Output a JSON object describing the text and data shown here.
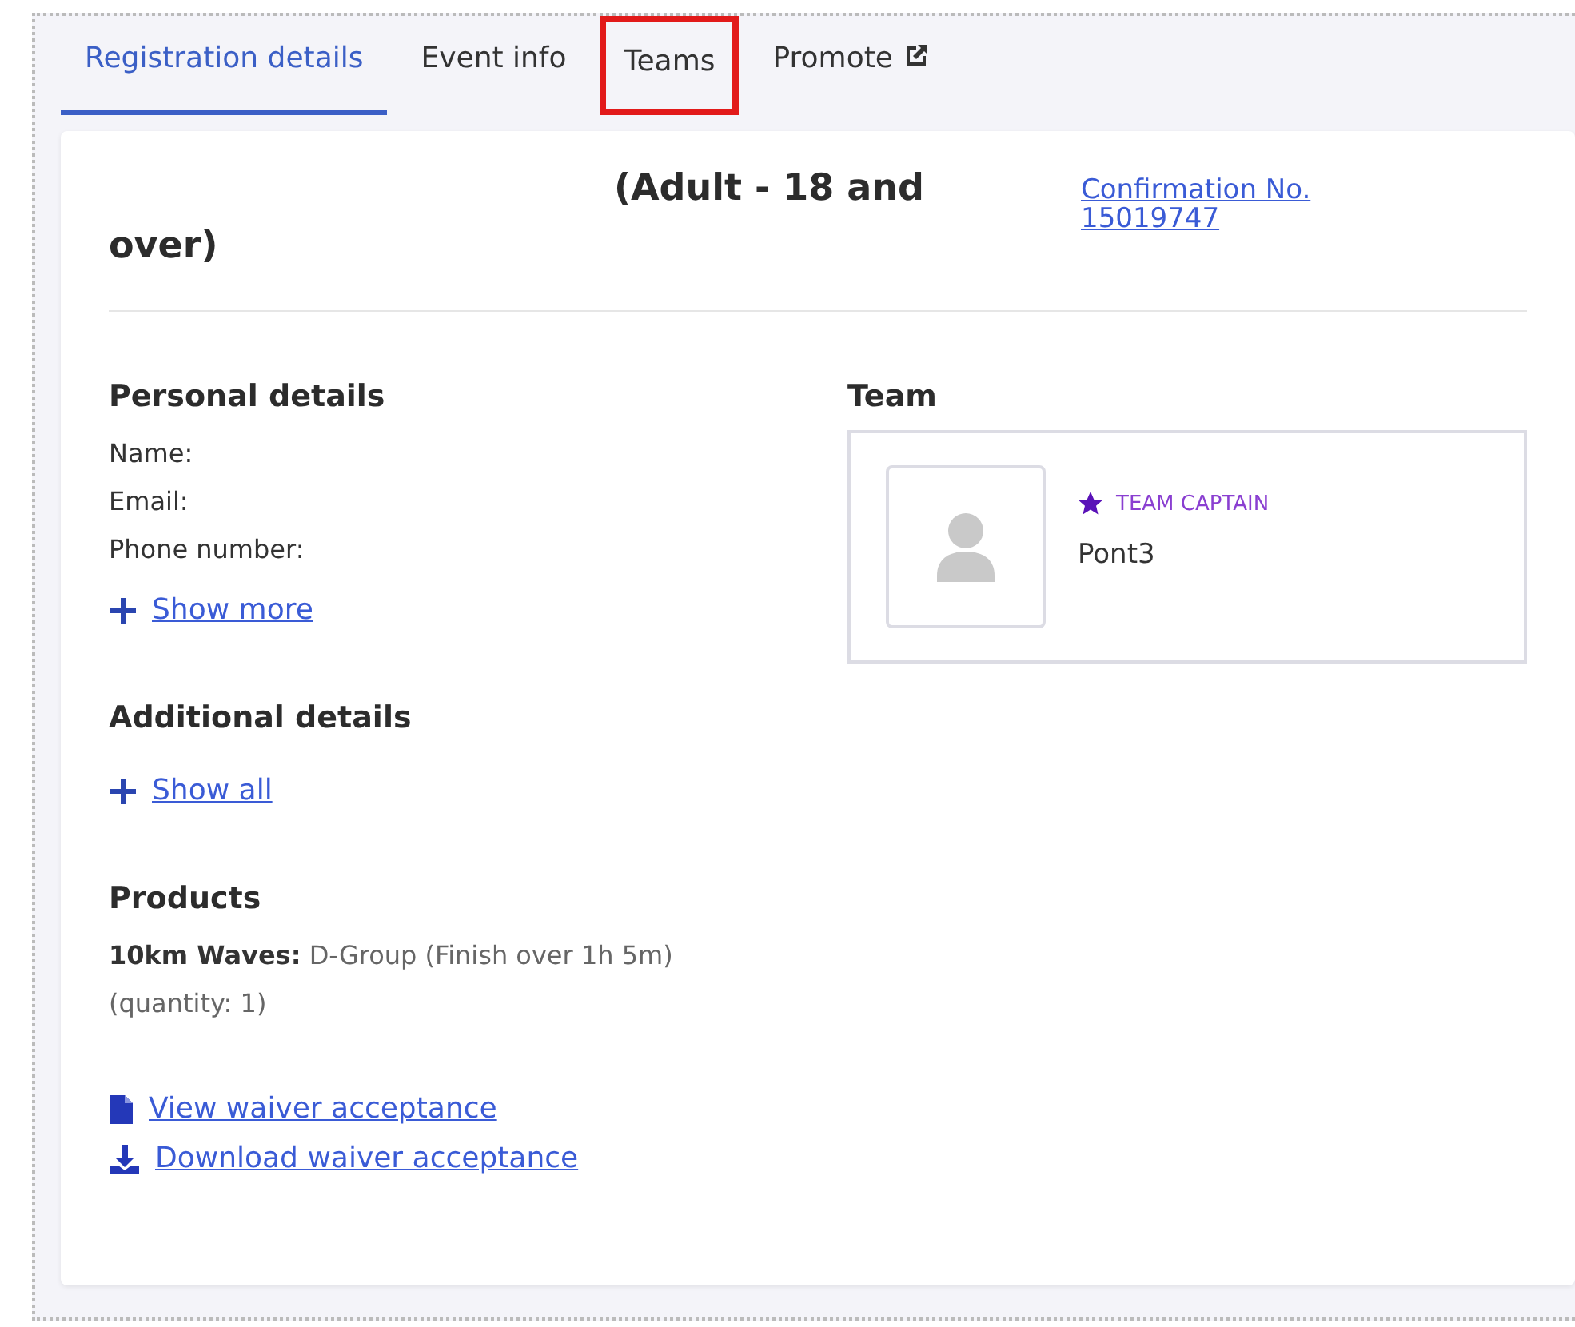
{
  "tabs": [
    {
      "label": "Registration details",
      "selected": true,
      "highlighted": false,
      "external": false
    },
    {
      "label": "Event info",
      "selected": false,
      "highlighted": false,
      "external": false
    },
    {
      "label": "Teams",
      "selected": false,
      "highlighted": true,
      "external": false
    },
    {
      "label": "Promote",
      "selected": false,
      "highlighted": false,
      "external": true
    }
  ],
  "heading": "(Adult - 18 and over)",
  "confirmation": {
    "label": "Confirmation No.",
    "number": "15019747"
  },
  "personal_details": {
    "title": "Personal details",
    "fields": [
      "Name:",
      "Email:",
      "Phone number:"
    ],
    "show_more": "Show more"
  },
  "team": {
    "title": "Team",
    "role": "TEAM CAPTAIN",
    "member": "Pont3"
  },
  "additional_details": {
    "title": "Additional details",
    "show_all": "Show all"
  },
  "products": {
    "title": "Products",
    "items": [
      "**10km Waves:** D-Group (Finish over 1h 5m) (quantity: 1)"
    ]
  },
  "waiver_links": [
    {
      "kind": "view",
      "label": "View waiver acceptance"
    },
    {
      "kind": "download",
      "label": "Download waiver acceptance"
    }
  ]
}
